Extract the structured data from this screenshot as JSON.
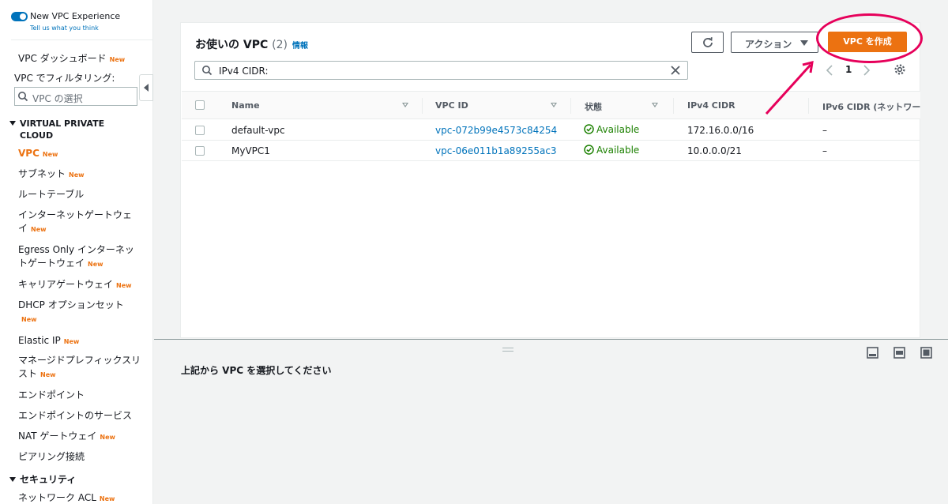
{
  "sidebar": {
    "experience_title": "New VPC Experience",
    "experience_link": "Tell us what you think",
    "dashboard": "VPC ダッシュボード",
    "new_badge": "New",
    "filter_label": "VPC でフィルタリング:",
    "filter_placeholder": "VPC の選択",
    "section_vpc_line1": "VIRTUAL PRIVATE",
    "section_vpc_line2": "CLOUD",
    "section_security": "セキュリティ",
    "items": [
      {
        "label": "VPC"
      },
      {
        "label": "サブネット"
      },
      {
        "label": "ルートテーブル"
      },
      {
        "label": "インターネットゲートウェイ"
      },
      {
        "label": "Egress Only インターネットゲートウェイ"
      },
      {
        "label": "キャリアゲートウェイ"
      },
      {
        "label": "DHCP オプションセット"
      },
      {
        "label": "Elastic IP"
      },
      {
        "label": "マネージドプレフィックスリスト"
      },
      {
        "label": "エンドポイント"
      },
      {
        "label": "エンドポイントのサービス"
      },
      {
        "label": "NAT ゲートウェイ"
      },
      {
        "label": "ピアリング接続"
      },
      {
        "label": "ネットワーク ACL"
      }
    ]
  },
  "main": {
    "title": "お使いの VPC",
    "count": "(2)",
    "info_link": "情報",
    "actions_label": "アクション",
    "create_label": "VPC を作成",
    "search_value": "IPv4 CIDR:",
    "page_number": "1",
    "columns": [
      "Name",
      "VPC ID",
      "状態",
      "IPv4 CIDR",
      "IPv6 CIDR (ネットワー"
    ],
    "rows": [
      {
        "name": "default-vpc",
        "vpc_id": "vpc-072b99e4573c84254",
        "status": "Available",
        "ipv4": "172.16.0.0/16",
        "ipv6": "–"
      },
      {
        "name": "MyVPC1",
        "vpc_id": "vpc-06e011b1a89255ac3",
        "status": "Available",
        "ipv4": "10.0.0.0/21",
        "ipv6": "–"
      }
    ]
  },
  "split": {
    "message": "上記から VPC を選択してください"
  },
  "colors": {
    "accent_orange": "#ec7211",
    "link_blue": "#0073bb",
    "status_green": "#1d8102",
    "annotation_pink": "#e6005a"
  }
}
